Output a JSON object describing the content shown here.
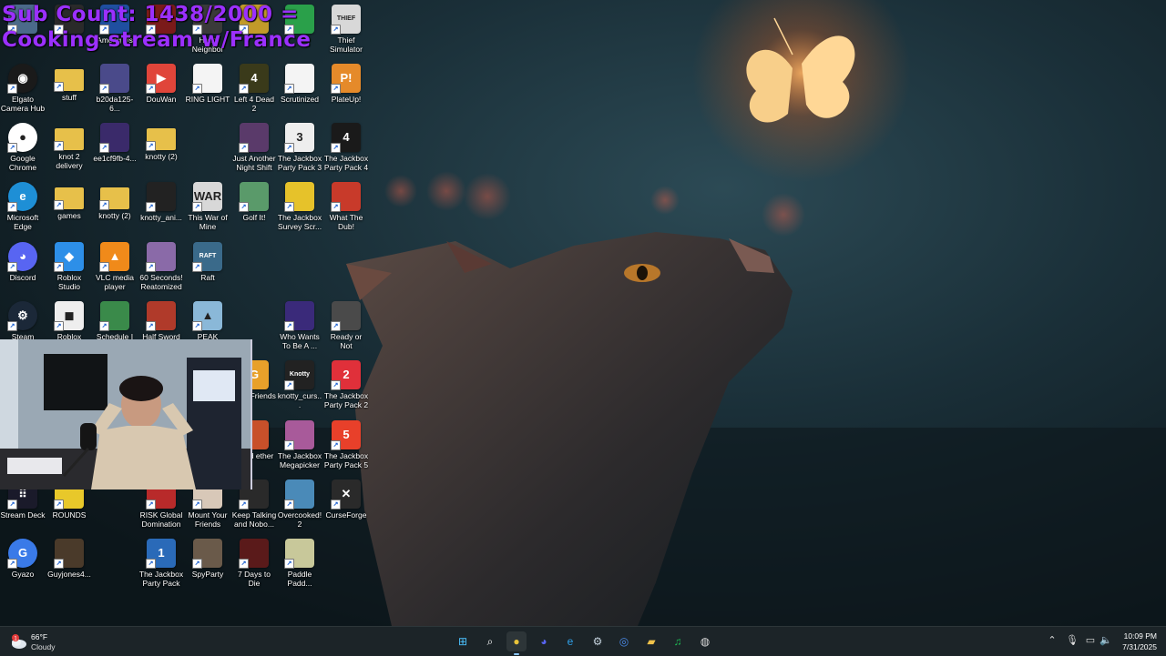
{
  "overlay": {
    "sub_count": "Sub Count: 1438/2000 =",
    "stream_note": "Cooking stream w/France",
    "color": "#9b30ff"
  },
  "desktop_icons": [
    {
      "label": "",
      "icon": "game-icon",
      "color": "#4b6a8a",
      "abbr": ""
    },
    {
      "label": "",
      "icon": "game-icon",
      "color": "#2a2a2a",
      "abbr": ""
    },
    {
      "label": "Among Us",
      "icon": "game-icon",
      "color": "#1f4fa0",
      "abbr": ""
    },
    {
      "label": "",
      "icon": "game-icon",
      "color": "#7a1a1a",
      "abbr": ""
    },
    {
      "label": "Hello Neighbor",
      "icon": "game-icon",
      "color": "#3a3a3a",
      "abbr": ""
    },
    {
      "label": "",
      "icon": "game-icon",
      "color": "#c29a2a",
      "abbr": ""
    },
    {
      "label": "",
      "icon": "game-icon",
      "color": "#2aa04a",
      "abbr": ""
    },
    {
      "label": "Thief Simulator",
      "icon": "game-icon",
      "color": "#d8d8d8",
      "abbr": "THIEF"
    },
    {
      "label": "Elgato Camera Hub",
      "icon": "camera-icon",
      "color": "#1a1a1a",
      "abbr": "◉"
    },
    {
      "label": "stuff",
      "icon": "folder-icon",
      "color": "#e7c04a",
      "abbr": ""
    },
    {
      "label": "b20da125-6...",
      "icon": "image-icon",
      "color": "#4a4a8a",
      "abbr": ""
    },
    {
      "label": "DouWan",
      "icon": "app-icon",
      "color": "#e0453a",
      "abbr": "▶"
    },
    {
      "label": "RING LIGHT",
      "icon": "document-icon",
      "color": "#f4f4f4",
      "abbr": ""
    },
    {
      "label": "Left 4 Dead 2",
      "icon": "game-icon",
      "color": "#3a3a1a",
      "abbr": "4"
    },
    {
      "label": "Scrutinized",
      "icon": "document-icon",
      "color": "#f4f4f4",
      "abbr": ""
    },
    {
      "label": "PlateUp!",
      "icon": "game-icon",
      "color": "#e58a2a",
      "abbr": "P!"
    },
    {
      "label": "Google Chrome",
      "icon": "chrome-icon",
      "color": "#ffffff",
      "abbr": "●"
    },
    {
      "label": "knot 2 delivery",
      "icon": "folder-icon",
      "color": "#e7c04a",
      "abbr": ""
    },
    {
      "label": "ee1cf9fb-4...",
      "icon": "image-icon",
      "color": "#3a2a6a",
      "abbr": ""
    },
    {
      "label": "knotty (2)",
      "icon": "folder-icon",
      "color": "#e7c04a",
      "abbr": ""
    },
    {
      "label": "Just Another Night Shift",
      "icon": "game-icon",
      "color": "#5a3a6a",
      "abbr": ""
    },
    {
      "label": "The Jackbox Party Pack 3",
      "icon": "game-icon",
      "color": "#eeeeee",
      "abbr": "3"
    },
    {
      "label": "The Jackbox Party Pack 4",
      "icon": "game-icon",
      "color": "#1a1a1a",
      "abbr": "4"
    },
    {
      "label": "Microsoft Edge",
      "icon": "edge-icon",
      "color": "#1e8fd6",
      "abbr": "e"
    },
    {
      "label": "games",
      "icon": "folder-icon",
      "color": "#e7c04a",
      "abbr": ""
    },
    {
      "label": "knotty (2)",
      "icon": "folder-icon",
      "color": "#e7c04a",
      "abbr": ""
    },
    {
      "label": "knotty_ani...",
      "icon": "video-icon",
      "color": "#222222",
      "abbr": ""
    },
    {
      "label": "This War of Mine",
      "icon": "game-icon",
      "color": "#d8d8d8",
      "abbr": "WAR"
    },
    {
      "label": "Golf It!",
      "icon": "game-icon",
      "color": "#5a9a6a",
      "abbr": ""
    },
    {
      "label": "The Jackbox Survey Scr...",
      "icon": "game-icon",
      "color": "#e6c22a",
      "abbr": ""
    },
    {
      "label": "What The Dub!",
      "icon": "game-icon",
      "color": "#c83a2a",
      "abbr": ""
    },
    {
      "label": "Discord",
      "icon": "discord-icon",
      "color": "#5865f2",
      "abbr": "◕"
    },
    {
      "label": "Roblox Studio",
      "icon": "roblox-studio-icon",
      "color": "#2d8fe8",
      "abbr": "◆"
    },
    {
      "label": "VLC media player",
      "icon": "vlc-icon",
      "color": "#f08a1a",
      "abbr": "▲"
    },
    {
      "label": "60 Seconds! Reatomized",
      "icon": "game-icon",
      "color": "#8a6aa8",
      "abbr": ""
    },
    {
      "label": "Raft",
      "icon": "game-icon",
      "color": "#3a6a8a",
      "abbr": "RAFT"
    },
    {
      "label": "Steam",
      "icon": "steam-icon",
      "color": "#1b2838",
      "abbr": "⚙"
    },
    {
      "label": "Roblox Player",
      "icon": "roblox-icon",
      "color": "#eeeeee",
      "abbr": "◼"
    },
    {
      "label": "Schedule I",
      "icon": "game-icon",
      "color": "#3a8a4a",
      "abbr": ""
    },
    {
      "label": "Half Sword",
      "icon": "game-icon",
      "color": "#b03a2a",
      "abbr": ""
    },
    {
      "label": "PEAK",
      "icon": "game-icon",
      "color": "#8ab8d8",
      "abbr": "▲"
    },
    {
      "label": "Who Wants To Be A ...",
      "icon": "game-icon",
      "color": "#3a2a7a",
      "abbr": ""
    },
    {
      "label": "Ready or Not",
      "icon": "game-icon",
      "color": "#4a4a4a",
      "abbr": ""
    },
    {
      "label": "With Friends",
      "icon": "game-icon",
      "color": "#e8a02a",
      "abbr": "G"
    },
    {
      "label": "knotty_curs...",
      "icon": "cursor-icon",
      "color": "#222222",
      "abbr": "Knotty"
    },
    {
      "label": "The Jackbox Party Pack 2",
      "icon": "game-icon",
      "color": "#e0303a",
      "abbr": "2"
    },
    {
      "label": "ained ether",
      "icon": "game-icon",
      "color": "#c8502a",
      "abbr": ""
    },
    {
      "label": "The Jackbox Megapicker",
      "icon": "game-icon",
      "color": "#a85a9a",
      "abbr": ""
    },
    {
      "label": "The Jackbox Party Pack 5",
      "icon": "game-icon",
      "color": "#e8402a",
      "abbr": "5"
    },
    {
      "label": "Stream Deck",
      "icon": "stream-deck-icon",
      "color": "#1a1a2a",
      "abbr": "⠿"
    },
    {
      "label": "ROUNDS",
      "icon": "game-icon",
      "color": "#e8c82a",
      "abbr": ""
    },
    {
      "label": "RISK Global Domination",
      "icon": "game-icon",
      "color": "#b82a2a",
      "abbr": ""
    },
    {
      "label": "Mount Your Friends",
      "icon": "game-icon",
      "color": "#d8c8b8",
      "abbr": ""
    },
    {
      "label": "Keep Talking and Nobo...",
      "icon": "game-icon",
      "color": "#2a2a2a",
      "abbr": ""
    },
    {
      "label": "Overcooked! 2",
      "icon": "game-icon",
      "color": "#4a8ab8",
      "abbr": ""
    },
    {
      "label": "CurseForge",
      "icon": "curseforge-icon",
      "color": "#2a2a2a",
      "abbr": "✕"
    },
    {
      "label": "Gyazo",
      "icon": "gyazo-icon",
      "color": "#3a7ae8",
      "abbr": "G"
    },
    {
      "label": "Guyjones4...",
      "icon": "image-icon",
      "color": "#4a3a2a",
      "abbr": ""
    },
    {
      "label": "The Jackbox Party Pack",
      "icon": "game-icon",
      "color": "#2a6ab8",
      "abbr": "1"
    },
    {
      "label": "SpyParty",
      "icon": "game-icon",
      "color": "#6a5a4a",
      "abbr": ""
    },
    {
      "label": "7 Days to Die",
      "icon": "game-icon",
      "color": "#5a1a1a",
      "abbr": ""
    },
    {
      "label": "Paddle Padd...",
      "icon": "game-icon",
      "color": "#c8c89a",
      "abbr": ""
    }
  ],
  "taskbar": {
    "weather": {
      "temp": "66°F",
      "condition": "Cloudy",
      "badge": "1"
    },
    "apps": [
      {
        "name": "start-button",
        "glyph": "⊞",
        "color": "#4cc2ff"
      },
      {
        "name": "search-button",
        "glyph": "⌕",
        "color": "#ffffff"
      },
      {
        "name": "taskbar-chrome",
        "glyph": "●",
        "color": "#e8c33a"
      },
      {
        "name": "taskbar-discord",
        "glyph": "◕",
        "color": "#5865f2"
      },
      {
        "name": "taskbar-edge",
        "glyph": "e",
        "color": "#2fa0e8"
      },
      {
        "name": "taskbar-steam",
        "glyph": "⚙",
        "color": "#c6d4df"
      },
      {
        "name": "taskbar-app",
        "glyph": "◎",
        "color": "#4a8ae8"
      },
      {
        "name": "taskbar-file-explorer",
        "glyph": "▰",
        "color": "#f0c24a"
      },
      {
        "name": "taskbar-spotify",
        "glyph": "♫",
        "color": "#1db954"
      },
      {
        "name": "taskbar-obs",
        "glyph": "◍",
        "color": "#dddddd"
      }
    ],
    "clock": {
      "time": "10:09 PM",
      "date": "7/31/2025"
    }
  }
}
